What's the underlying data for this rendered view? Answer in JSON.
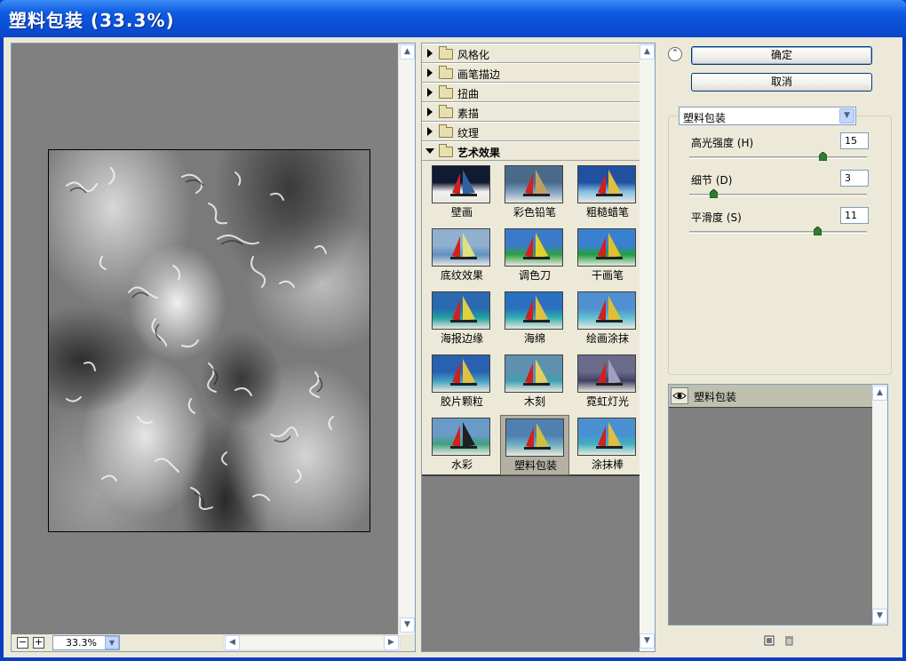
{
  "window": {
    "title": "塑料包装 (33.3%)"
  },
  "preview": {
    "zoom": "33.3%",
    "zoom_out": "−",
    "zoom_in": "+"
  },
  "categories": [
    {
      "label": "风格化",
      "open": false
    },
    {
      "label": "画笔描边",
      "open": false
    },
    {
      "label": "扭曲",
      "open": false
    },
    {
      "label": "素描",
      "open": false
    },
    {
      "label": "纹理",
      "open": false
    },
    {
      "label": "艺术效果",
      "open": true
    }
  ],
  "thumbnails": [
    {
      "label": "壁画"
    },
    {
      "label": "彩色铅笔"
    },
    {
      "label": "粗糙蜡笔"
    },
    {
      "label": "底纹效果"
    },
    {
      "label": "调色刀"
    },
    {
      "label": "干画笔"
    },
    {
      "label": "海报边缘"
    },
    {
      "label": "海绵"
    },
    {
      "label": "绘画涂抹"
    },
    {
      "label": "胶片颗粒"
    },
    {
      "label": "木刻"
    },
    {
      "label": "霓虹灯光"
    },
    {
      "label": "水彩"
    },
    {
      "label": "塑料包装"
    },
    {
      "label": "涂抹棒"
    }
  ],
  "selected_thumbnail": "塑料包装",
  "buttons": {
    "ok": "确定",
    "cancel": "取消"
  },
  "filter_select": {
    "value": "塑料包装"
  },
  "params": [
    {
      "label": "高光强度 (H)",
      "value": "15",
      "level_fraction": 0.75
    },
    {
      "label": "细节 (D)",
      "value": "3",
      "level_fraction": 0.133
    },
    {
      "label": "平滑度 (S)",
      "value": "11",
      "level_fraction": 0.72
    }
  ],
  "layers": [
    {
      "name": "塑料包装",
      "visible": true
    }
  ],
  "icons": {
    "collapse": "double-chevron-up-icon",
    "eye": "eye-icon",
    "new_layer": "new-layer-icon",
    "delete": "trash-icon"
  }
}
